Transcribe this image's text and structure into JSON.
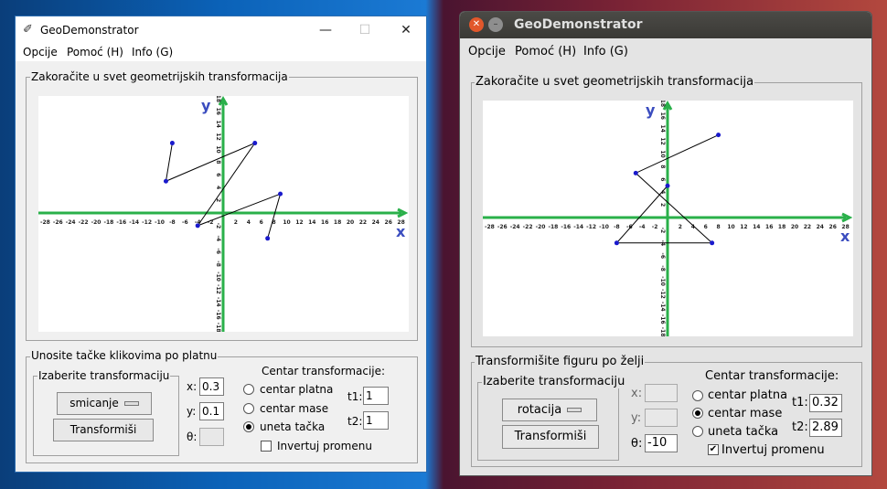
{
  "win1": {
    "title": "GeoDemonstrator",
    "controls": {
      "minimize": "—",
      "maximize": "☐",
      "close": "✕"
    },
    "menu": [
      "Opcije",
      "Pomoć (H)",
      "Info (G)"
    ],
    "canvas_frame_label": "Zakoračite u svet geometrijskih transformacija",
    "bottom_frame_label": "Unosite tačke klikovima po platnu",
    "transform_frame_label": "Izaberite transformaciju",
    "transform_option": "smicanje",
    "transform_button": "Transformiši",
    "x_label": "x:",
    "x_value": "0.3",
    "y_label": "y:",
    "y_value": "0.1",
    "theta_label": "θ:",
    "theta_value": "",
    "center_label": "Centar transformacije:",
    "radio": [
      "centar platna",
      "centar mase",
      "uneta tačka"
    ],
    "t1_label": "t1:",
    "t1_value": "1",
    "t2_label": "t2:",
    "t2_value": "1",
    "invert_label": "Invertuj promenu",
    "axis_x": "x",
    "axis_y": "y",
    "polyline": [
      [
        -8,
        11
      ],
      [
        -9,
        5
      ],
      [
        5,
        11
      ],
      [
        -4,
        -2
      ],
      [
        9,
        3
      ],
      [
        7,
        -4
      ]
    ]
  },
  "win2": {
    "title": "GeoDemonstrator",
    "menu": [
      "Opcije",
      "Pomoć (H)",
      "Info (G)"
    ],
    "canvas_frame_label": "Zakoračite u svet geometrijskih transformacija",
    "bottom_frame_label": "Transformišite figuru po želji",
    "transform_frame_label": "Izaberite transformaciju",
    "transform_option": "rotacija",
    "transform_button": "Transformiši",
    "x_label": "x:",
    "x_value": "",
    "y_label": "y:",
    "y_value": "",
    "theta_label": "θ:",
    "theta_value": "-10",
    "center_label": "Centar transformacije:",
    "radio": [
      "centar platna",
      "centar mase",
      "uneta tačka"
    ],
    "t1_label": "t1:",
    "t1_value": "0.32",
    "t2_label": "t2:",
    "t2_value": "2.89",
    "invert_label": "Invertuj promenu",
    "axis_x": "x",
    "axis_y": "y",
    "polyline": [
      [
        8,
        13
      ],
      [
        -5,
        7
      ],
      [
        7,
        -4
      ],
      [
        -8,
        -4
      ],
      [
        0,
        5
      ]
    ]
  },
  "colors": {
    "axis": "#2ab04a",
    "point": "#1a1acc",
    "axis_label": "#3b4dbf"
  },
  "ticks": [
    -28,
    -26,
    -24,
    -22,
    -20,
    -18,
    -16,
    -14,
    -12,
    -10,
    -8,
    -6,
    -4,
    -2,
    2,
    4,
    6,
    8,
    10,
    12,
    14,
    16,
    18,
    20,
    22,
    24,
    26,
    28
  ]
}
